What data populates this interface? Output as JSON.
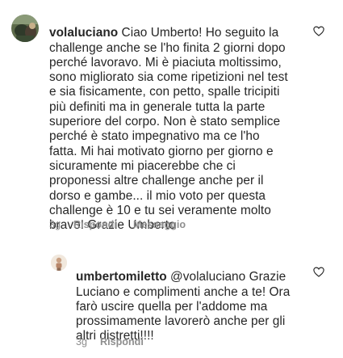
{
  "comments": [
    {
      "username": "volaluciano",
      "text": " Ciao Umberto! Ho seguito la\nchallenge anche se l'ho finita 2 giorni dopo\nperché lavoravo. Mi è piaciuta moltissimo,\nsono migliorato sia come ripetizioni nel test\ne sia fisicamente, con petto, spalle tricipiti\npiù definiti ma in generale tutta la parte\nsuperiore del  corpo. Non è stato semplice\nperché è stato impegnativo ma ce l'ho\nfatta. Mi hai motivato giorno per giorno e\nsicuramente mi piacerebbe che ci\nproponessi altre challenge anche per il\ndorso e gambe... il mio voto per questa\nchallenge è 10 e tu sei veramente molto\nbravo! Grazie Umberto",
      "time": "3g",
      "reply_label": "Rispondi",
      "message_label": "Messaggio",
      "like_icon": "heart-outline-icon"
    },
    {
      "username": "umbertomiletto",
      "text": " @volaluciano Grazie\nLuciano e complimenti anche a te! Ora\nfarò uscire quella per l'addome ma\nprossimamente lavorerò anche per gli\naltri distretti!!!!",
      "time": "3g",
      "reply_label": "Rispondi",
      "like_icon": "heart-outline-icon"
    }
  ],
  "colors": {
    "text": "#262626",
    "secondary": "#8e8e8e",
    "background": "#ffffff"
  }
}
